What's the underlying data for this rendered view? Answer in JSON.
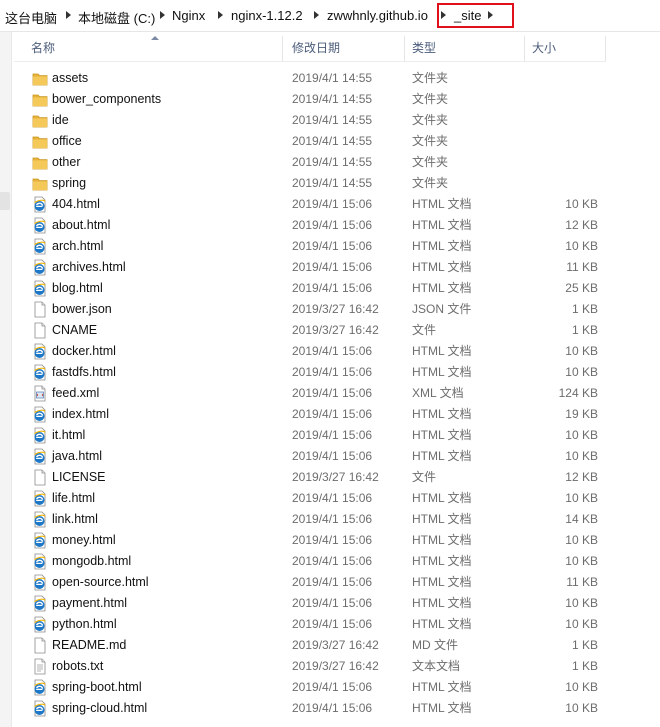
{
  "breadcrumb": {
    "items": [
      "这台电脑",
      "本地磁盘 (C:)",
      "Nginx",
      "nginx-1.12.2",
      "zwwhnly.github.io",
      "_site"
    ]
  },
  "columns": {
    "name": "名称",
    "date": "修改日期",
    "type": "类型",
    "size": "大小"
  },
  "colors": {
    "highlight": "#e0101a",
    "folder": "#e8b23a",
    "header_text": "#4c5d7a"
  },
  "files": [
    {
      "name": "assets",
      "date": "2019/4/1 14:55",
      "type": "文件夹",
      "size": "",
      "icon": "folder-icon"
    },
    {
      "name": "bower_components",
      "date": "2019/4/1 14:55",
      "type": "文件夹",
      "size": "",
      "icon": "folder-icon"
    },
    {
      "name": "ide",
      "date": "2019/4/1 14:55",
      "type": "文件夹",
      "size": "",
      "icon": "folder-icon"
    },
    {
      "name": "office",
      "date": "2019/4/1 14:55",
      "type": "文件夹",
      "size": "",
      "icon": "folder-icon"
    },
    {
      "name": "other",
      "date": "2019/4/1 14:55",
      "type": "文件夹",
      "size": "",
      "icon": "folder-icon"
    },
    {
      "name": "spring",
      "date": "2019/4/1 14:55",
      "type": "文件夹",
      "size": "",
      "icon": "folder-icon"
    },
    {
      "name": "404.html",
      "date": "2019/4/1 15:06",
      "type": "HTML 文档",
      "size": "10 KB",
      "icon": "html-file-icon"
    },
    {
      "name": "about.html",
      "date": "2019/4/1 15:06",
      "type": "HTML 文档",
      "size": "12 KB",
      "icon": "html-file-icon"
    },
    {
      "name": "arch.html",
      "date": "2019/4/1 15:06",
      "type": "HTML 文档",
      "size": "10 KB",
      "icon": "html-file-icon"
    },
    {
      "name": "archives.html",
      "date": "2019/4/1 15:06",
      "type": "HTML 文档",
      "size": "11 KB",
      "icon": "html-file-icon"
    },
    {
      "name": "blog.html",
      "date": "2019/4/1 15:06",
      "type": "HTML 文档",
      "size": "25 KB",
      "icon": "html-file-icon"
    },
    {
      "name": "bower.json",
      "date": "2019/3/27 16:42",
      "type": "JSON 文件",
      "size": "1 KB",
      "icon": "blank-file-icon"
    },
    {
      "name": "CNAME",
      "date": "2019/3/27 16:42",
      "type": "文件",
      "size": "1 KB",
      "icon": "blank-file-icon"
    },
    {
      "name": "docker.html",
      "date": "2019/4/1 15:06",
      "type": "HTML 文档",
      "size": "10 KB",
      "icon": "html-file-icon"
    },
    {
      "name": "fastdfs.html",
      "date": "2019/4/1 15:06",
      "type": "HTML 文档",
      "size": "10 KB",
      "icon": "html-file-icon"
    },
    {
      "name": "feed.xml",
      "date": "2019/4/1 15:06",
      "type": "XML 文档",
      "size": "124 KB",
      "icon": "xml-file-icon"
    },
    {
      "name": "index.html",
      "date": "2019/4/1 15:06",
      "type": "HTML 文档",
      "size": "19 KB",
      "icon": "html-file-icon"
    },
    {
      "name": "it.html",
      "date": "2019/4/1 15:06",
      "type": "HTML 文档",
      "size": "10 KB",
      "icon": "html-file-icon"
    },
    {
      "name": "java.html",
      "date": "2019/4/1 15:06",
      "type": "HTML 文档",
      "size": "10 KB",
      "icon": "html-file-icon"
    },
    {
      "name": "LICENSE",
      "date": "2019/3/27 16:42",
      "type": "文件",
      "size": "12 KB",
      "icon": "blank-file-icon"
    },
    {
      "name": "life.html",
      "date": "2019/4/1 15:06",
      "type": "HTML 文档",
      "size": "10 KB",
      "icon": "html-file-icon"
    },
    {
      "name": "link.html",
      "date": "2019/4/1 15:06",
      "type": "HTML 文档",
      "size": "14 KB",
      "icon": "html-file-icon"
    },
    {
      "name": "money.html",
      "date": "2019/4/1 15:06",
      "type": "HTML 文档",
      "size": "10 KB",
      "icon": "html-file-icon"
    },
    {
      "name": "mongodb.html",
      "date": "2019/4/1 15:06",
      "type": "HTML 文档",
      "size": "10 KB",
      "icon": "html-file-icon"
    },
    {
      "name": "open-source.html",
      "date": "2019/4/1 15:06",
      "type": "HTML 文档",
      "size": "11 KB",
      "icon": "html-file-icon"
    },
    {
      "name": "payment.html",
      "date": "2019/4/1 15:06",
      "type": "HTML 文档",
      "size": "10 KB",
      "icon": "html-file-icon"
    },
    {
      "name": "python.html",
      "date": "2019/4/1 15:06",
      "type": "HTML 文档",
      "size": "10 KB",
      "icon": "html-file-icon"
    },
    {
      "name": "README.md",
      "date": "2019/3/27 16:42",
      "type": "MD 文件",
      "size": "1 KB",
      "icon": "blank-file-icon"
    },
    {
      "name": "robots.txt",
      "date": "2019/3/27 16:42",
      "type": "文本文档",
      "size": "1 KB",
      "icon": "text-file-icon"
    },
    {
      "name": "spring-boot.html",
      "date": "2019/4/1 15:06",
      "type": "HTML 文档",
      "size": "10 KB",
      "icon": "html-file-icon"
    },
    {
      "name": "spring-cloud.html",
      "date": "2019/4/1 15:06",
      "type": "HTML 文档",
      "size": "10 KB",
      "icon": "html-file-icon"
    }
  ]
}
